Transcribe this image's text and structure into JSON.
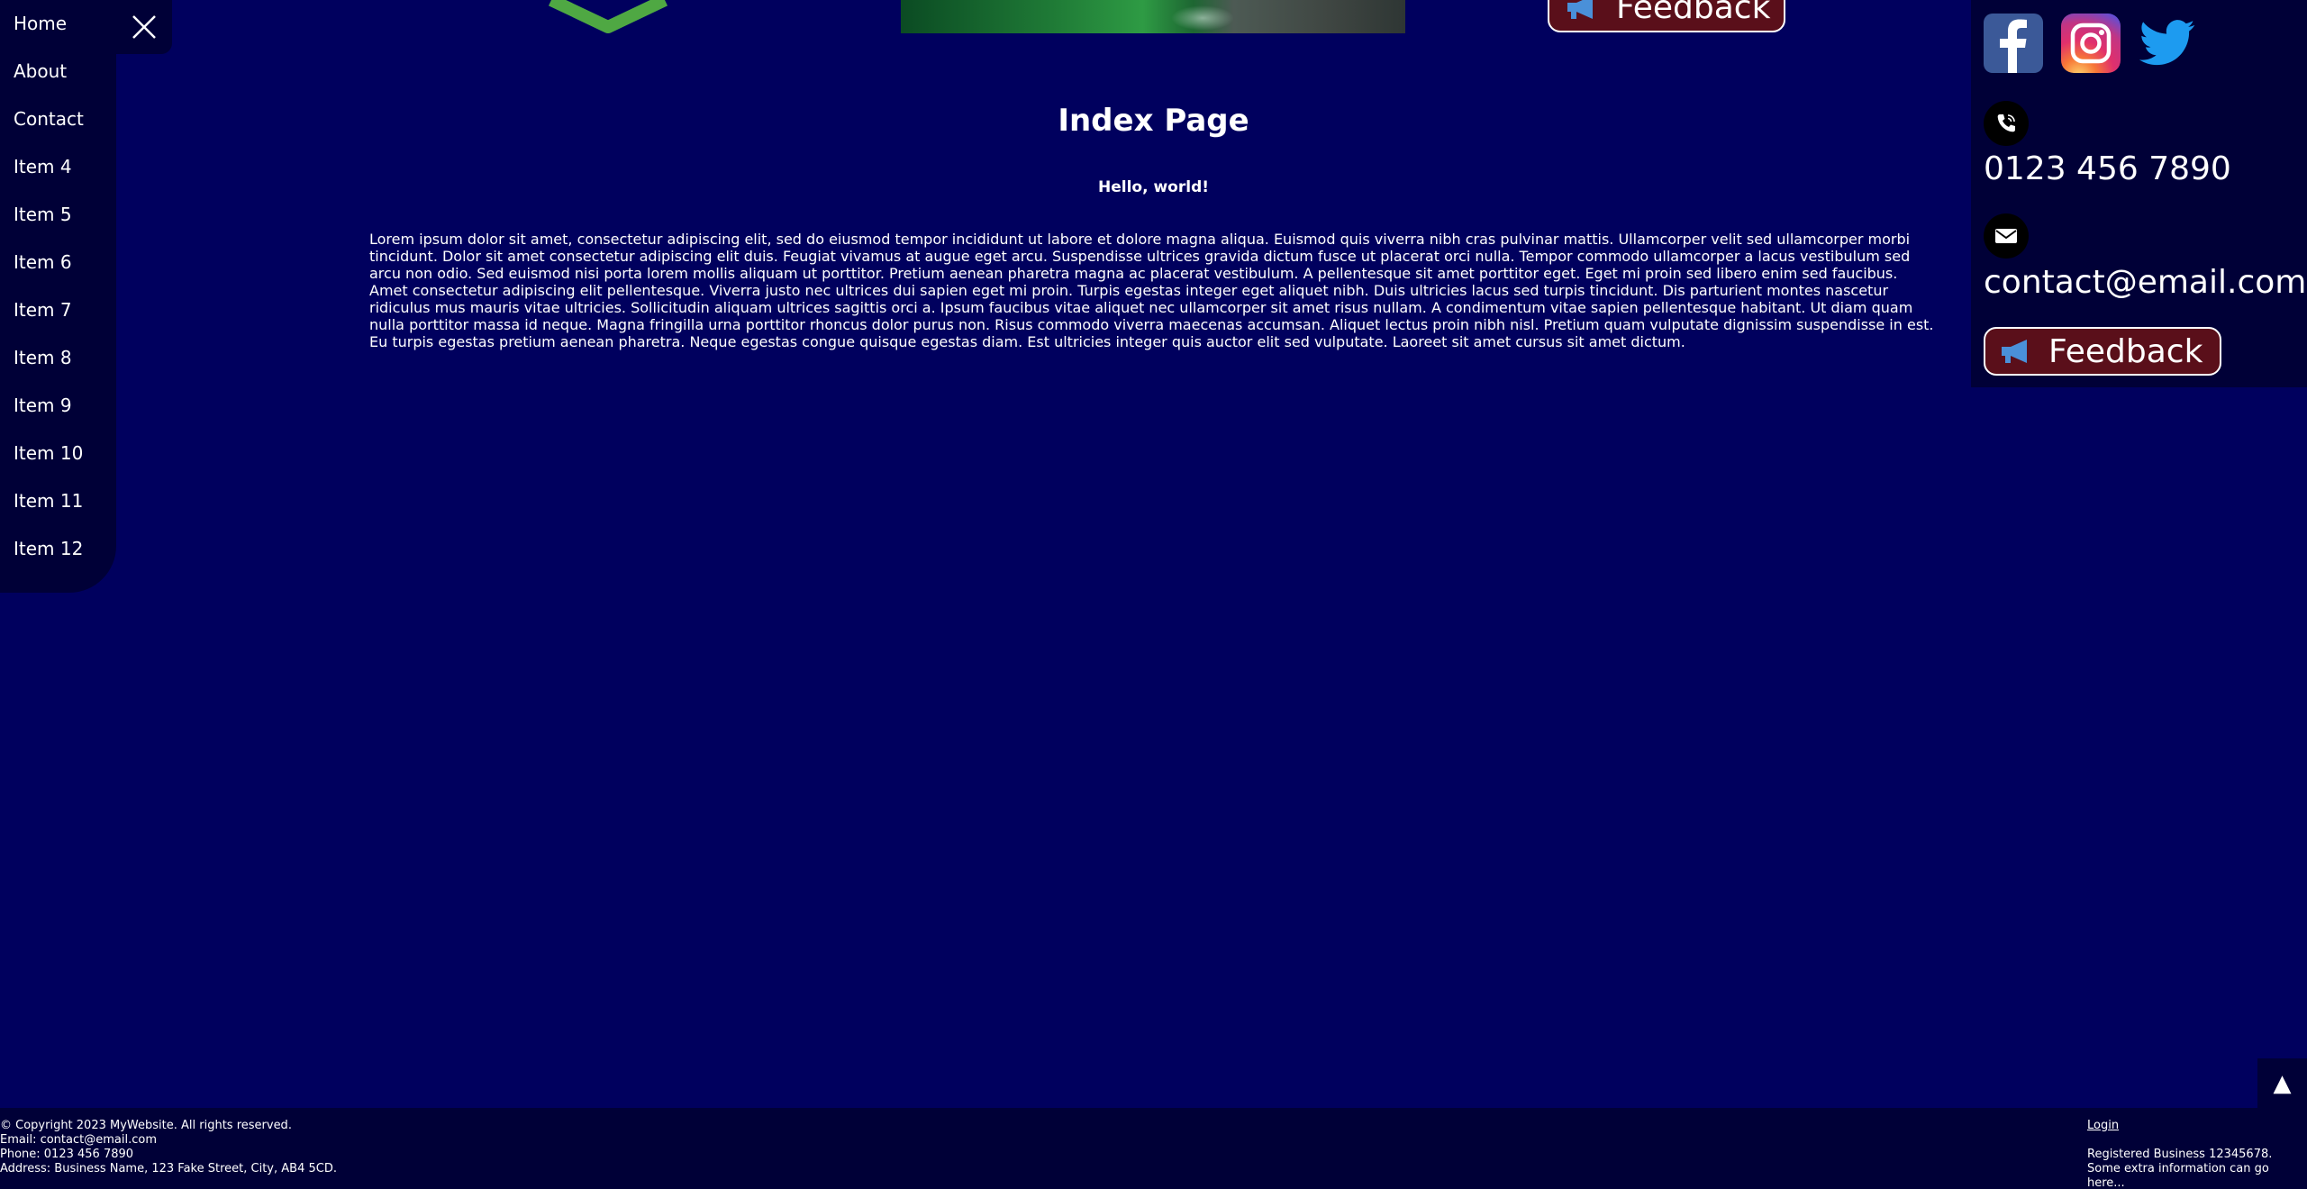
{
  "nav": {
    "items": [
      {
        "label": "Home"
      },
      {
        "label": "About"
      },
      {
        "label": "Contact"
      },
      {
        "label": "Item 4"
      },
      {
        "label": "Item 5"
      },
      {
        "label": "Item 6"
      },
      {
        "label": "Item 7"
      },
      {
        "label": "Item 8"
      },
      {
        "label": "Item 9"
      },
      {
        "label": "Item 10"
      },
      {
        "label": "Item 11"
      },
      {
        "label": "Item 12"
      }
    ],
    "close_icon": "close-icon"
  },
  "header": {
    "feedback_label": "Feedback",
    "feedback_icon": "megaphone-icon"
  },
  "main": {
    "title": "Index Page",
    "subtitle": "Hello, world!",
    "body": "Lorem ipsum dolor sit amet, consectetur adipiscing elit, sed do eiusmod tempor incididunt ut labore et dolore magna aliqua. Euismod quis viverra nibh cras pulvinar mattis. Ullamcorper velit sed ullamcorper morbi tincidunt. Dolor sit amet consectetur adipiscing elit duis. Feugiat vivamus at augue eget arcu. Suspendisse ultrices gravida dictum fusce ut placerat orci nulla. Tempor commodo ullamcorper a lacus vestibulum sed arcu non odio. Sed euismod nisi porta lorem mollis aliquam ut porttitor. Pretium aenean pharetra magna ac placerat vestibulum. A pellentesque sit amet porttitor eget. Eget mi proin sed libero enim sed faucibus. Amet consectetur adipiscing elit pellentesque. Viverra justo nec ultrices dui sapien eget mi proin. Turpis egestas integer eget aliquet nibh. Duis ultricies lacus sed turpis tincidunt. Dis parturient montes nascetur ridiculus mus mauris vitae ultricies. Sollicitudin aliquam ultrices sagittis orci a. Ipsum faucibus vitae aliquet nec ullamcorper sit amet risus nullam. A condimentum vitae sapien pellentesque habitant. Ut diam quam nulla porttitor massa id neque. Magna fringilla urna porttitor rhoncus dolor purus non. Risus commodo viverra maecenas accumsan. Aliquet lectus proin nibh nisl. Pretium quam vulputate dignissim suspendisse in est. Eu turpis egestas pretium aenean pharetra. Neque egestas congue quisque egestas diam. Est ultricies integer quis auctor elit sed vulputate. Laoreet sit amet cursus sit amet dictum."
  },
  "contact": {
    "social": [
      "facebook-icon",
      "instagram-icon",
      "twitter-icon"
    ],
    "phone": "0123 456 7890",
    "email": "contact@email.com",
    "feedback_label": "Feedback"
  },
  "scroll_top": {
    "glyph": "▲"
  },
  "footer": {
    "copyright": "© Copyright 2023 MyWebsite. All rights reserved.",
    "email": "Email: contact@email.com",
    "phone": "Phone: 0123 456 7890",
    "address": "Address: Business Name, 123 Fake Street, City, AB4 5CD.",
    "login": "Login",
    "registered": "Registered Business 12345678.",
    "extra": "Some extra information can go here..."
  },
  "colors": {
    "background": "#00005e",
    "panel": "#000037",
    "feedback_bg": "#5a0f1a",
    "logo_green": "#4fa843",
    "twitter": "#1d9bf0",
    "facebook": "#3b5998"
  }
}
